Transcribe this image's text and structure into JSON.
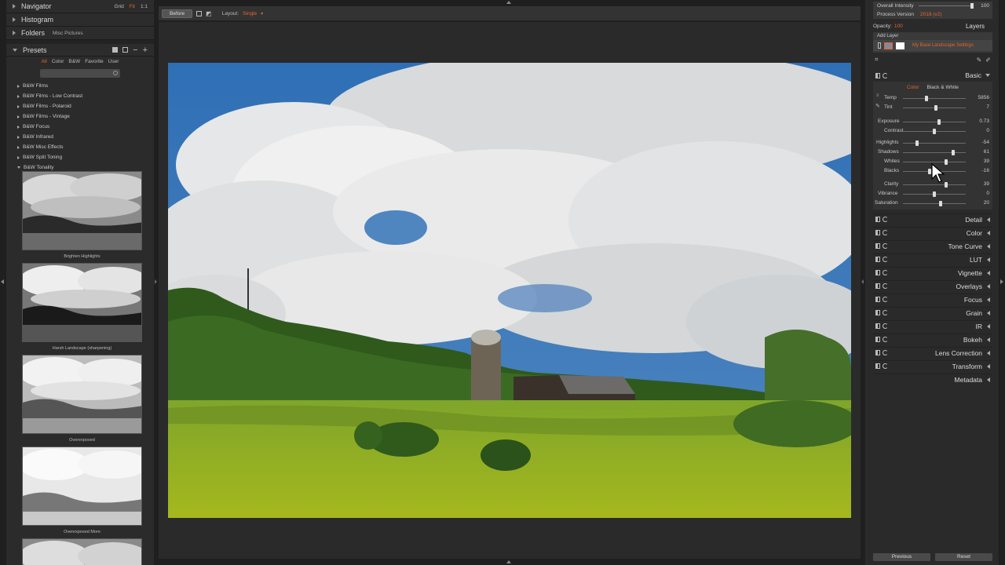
{
  "left_panel": {
    "navigator": {
      "label": "Navigator",
      "options": [
        "Grid",
        "Fit",
        "1:1"
      ]
    },
    "histogram": {
      "label": "Histogram"
    },
    "folders": {
      "label": "Folders",
      "current": "Misc Pictures"
    },
    "presets": {
      "label": "Presets",
      "tabs": [
        "All",
        "Color",
        "B&W",
        "Favorite",
        "User"
      ],
      "active_tab": "All",
      "categories": [
        "B&W Films",
        "B&W Films - Low Contrast",
        "B&W Films - Polaroid",
        "B&W Films - Vintage",
        "B&W Focus",
        "B&W Infrared",
        "B&W Misc Effects",
        "B&W Split Toning",
        "B&W Tonality"
      ],
      "thumbnails": [
        "Brighten Highlights",
        "Harsh Landscape (sharpening)",
        "Overexposed",
        "Overexposed More"
      ]
    }
  },
  "toolbar": {
    "before_label": "Before",
    "layout_label": "Layout:",
    "layout_value": "Single"
  },
  "right_panel": {
    "overall_intensity": {
      "label": "Overall Intensity",
      "value": "100"
    },
    "process_version": {
      "label": "Process Version",
      "value": "2018 (v2)"
    },
    "opacity": {
      "label": "Opacity:",
      "value": "100"
    },
    "layers_label": "Layers",
    "add_layer": "Add Layer",
    "layer_name": "My Base Landscape Settings",
    "basic": {
      "label": "Basic",
      "tabs": [
        "Color",
        "Black & White"
      ],
      "active_tab": "Color",
      "sliders": [
        {
          "label": "Temp",
          "value": "5856",
          "pos": 0.38
        },
        {
          "label": "Tint",
          "value": "7",
          "pos": 0.53
        },
        {
          "label": "Exposure",
          "value": "0.73",
          "pos": 0.57
        },
        {
          "label": "Contrast",
          "value": "0",
          "pos": 0.5
        },
        {
          "label": "Highlights",
          "value": "-54",
          "pos": 0.23
        },
        {
          "label": "Shadows",
          "value": "61",
          "pos": 0.8
        },
        {
          "label": "Whites",
          "value": "39",
          "pos": 0.69
        },
        {
          "label": "Blacks",
          "value": "-16",
          "pos": 0.42
        },
        {
          "label": "Clarity",
          "value": "39",
          "pos": 0.69
        },
        {
          "label": "Vibrance",
          "value": "0",
          "pos": 0.5
        },
        {
          "label": "Saturation",
          "value": "20",
          "pos": 0.6
        }
      ]
    },
    "sections": [
      "Detail",
      "Color",
      "Tone Curve",
      "LUT",
      "Vignette",
      "Overlays",
      "Focus",
      "Grain",
      "IR",
      "Bokeh",
      "Lens Correction",
      "Transform"
    ],
    "metadata": "Metadata",
    "previous_label": "Previous",
    "reset_label": "Reset"
  },
  "colors": {
    "accent": "#e0662e",
    "panel": "#2b2b2b",
    "background": "#1f1f1f"
  }
}
